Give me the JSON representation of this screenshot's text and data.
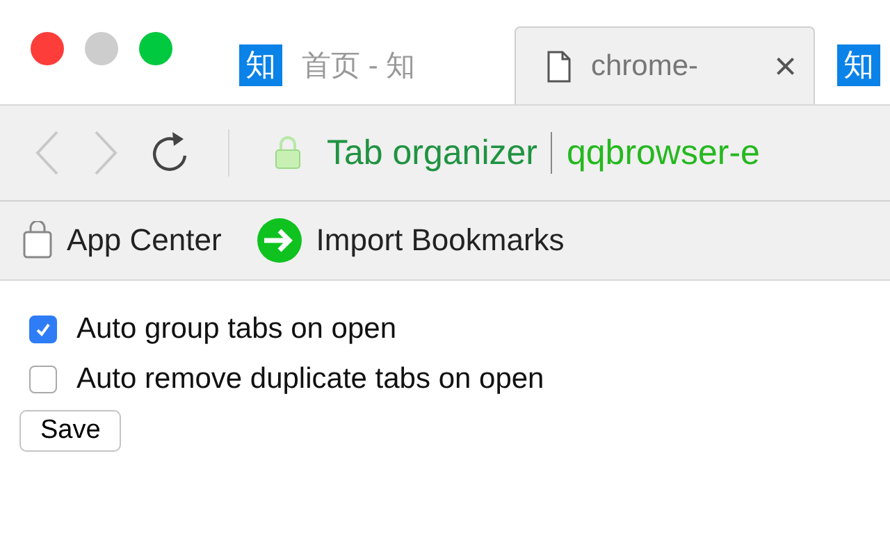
{
  "tabs": [
    {
      "favicon_text": "知",
      "title": "首页 - 知",
      "selected": false,
      "kind": "site"
    },
    {
      "title": "chrome-",
      "close": "×",
      "selected": true,
      "kind": "page"
    },
    {
      "favicon_text": "知",
      "selected": false,
      "kind": "site"
    }
  ],
  "toolbar": {
    "site_name": "Tab organizer",
    "address": "qqbrowser-e"
  },
  "bookmarks": [
    {
      "label": "App Center",
      "kind": "bag"
    },
    {
      "label": "Import Bookmarks",
      "kind": "import"
    }
  ],
  "options": [
    {
      "label": "Auto group tabs on open",
      "checked": true
    },
    {
      "label": "Auto remove duplicate tabs on open",
      "checked": false
    }
  ],
  "save_button": "Save"
}
